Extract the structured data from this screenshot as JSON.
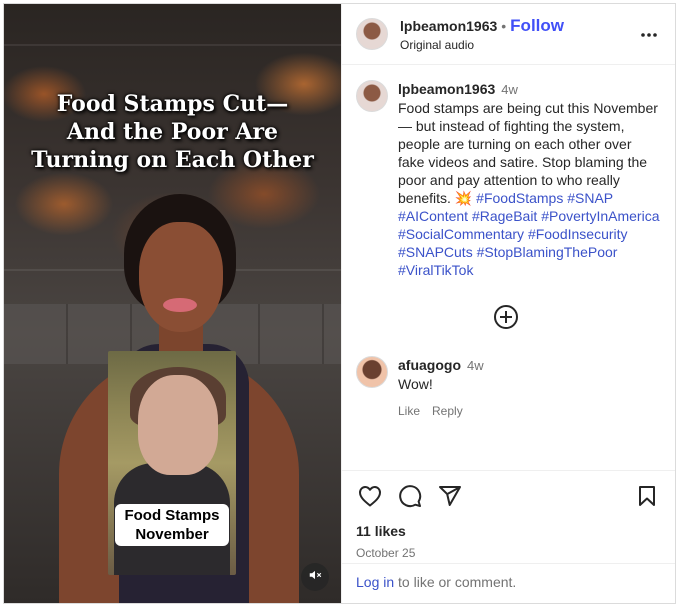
{
  "media": {
    "overlay_title": "Food Stamps Cut—\nAnd the Poor Are\nTurning on Each Other",
    "inset_caption": "Food Stamps\nNovember",
    "mute_icon": "speaker-muted-icon"
  },
  "header": {
    "username": "lpbeamon1963",
    "separator": "•",
    "follow_label": "Follow",
    "audio": "Original audio",
    "more_icon": "more-horizontal-icon"
  },
  "caption": {
    "username": "lpbeamon1963",
    "time": "4w",
    "text": "Food stamps are being cut this November — but instead of fighting the system, people are turning on each other over fake videos and satire. Stop blaming the poor and pay attention to who really benefits. ",
    "emoji": "💥",
    "hashtags": "#FoodStamps #SNAP #AIContent #RageBait #PovertyInAmerica #SocialCommentary #FoodInsecurity #SNAPCuts #StopBlamingThePoor #ViralTikTok"
  },
  "load_more_icon": "plus-circle-icon",
  "comment": {
    "username": "afuagogo",
    "time": "4w",
    "text": "Wow!",
    "like_label": "Like",
    "reply_label": "Reply"
  },
  "actions": {
    "like_icon": "heart-icon",
    "comment_icon": "comment-icon",
    "share_icon": "share-icon",
    "save_icon": "bookmark-icon",
    "likes": "11 likes",
    "date": "October 25"
  },
  "login": {
    "link": "Log in",
    "rest": " to like or comment."
  },
  "colors": {
    "follow": "#4150f7",
    "hashtag": "#3b52c9",
    "muted_text": "#737373",
    "border": "#dbdbdb"
  }
}
